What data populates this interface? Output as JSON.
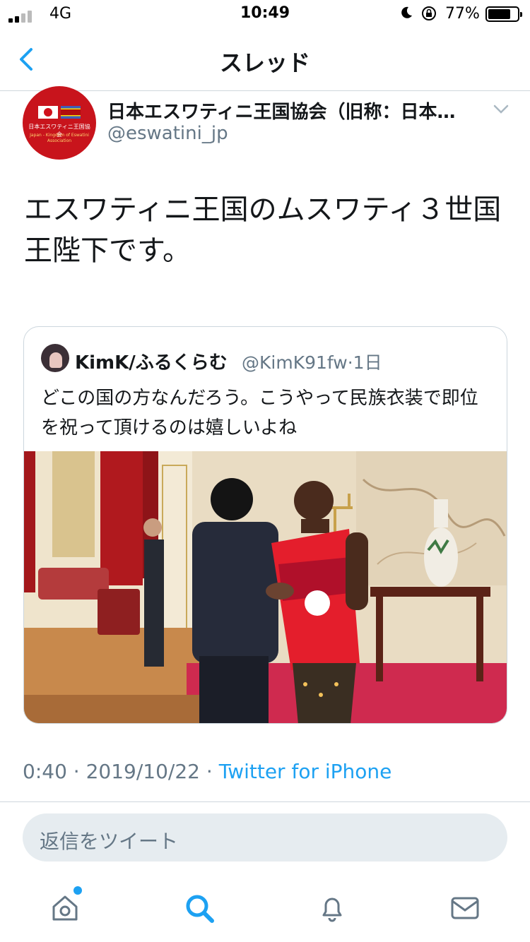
{
  "status_bar": {
    "carrier": "4G",
    "time": "10:49",
    "battery_percent": "77%",
    "battery_level": 0.77,
    "icons": [
      "signal-icon",
      "moon-icon",
      "orientation-lock-icon",
      "battery-icon"
    ]
  },
  "nav": {
    "title": "スレッド",
    "back_icon": "chevron-left-icon"
  },
  "tweet": {
    "display_name": "日本エスワティニ王国協会（旧称：日本…",
    "handle": "@eswatini_jp",
    "avatar_text": "日本エスワティニ王国協会",
    "avatar_subtext": "Japan - Kingdom of Eswatini Association",
    "text": "エスワティニ王国のムスワティ３世国王陛下です。",
    "time": "0:40",
    "date": "2019/10/22",
    "separator": "·",
    "client": "Twitter for iPhone"
  },
  "quote": {
    "display_name": "KimK/ふるくらむ",
    "handle": "@KimK91fw",
    "age": "1日",
    "text": "どこの国の方なんだろう。こうやって民族衣装で即位を祝って頂けるのは嬉しいよね"
  },
  "reply": {
    "placeholder": "返信をツイート"
  },
  "tabbar": {
    "items": [
      "home-icon",
      "search-icon",
      "notifications-icon",
      "messages-icon"
    ],
    "notification_dot": true
  },
  "colors": {
    "accent": "#1da1f2",
    "secondary_text": "#657786",
    "avatar_red": "#c8141c"
  }
}
